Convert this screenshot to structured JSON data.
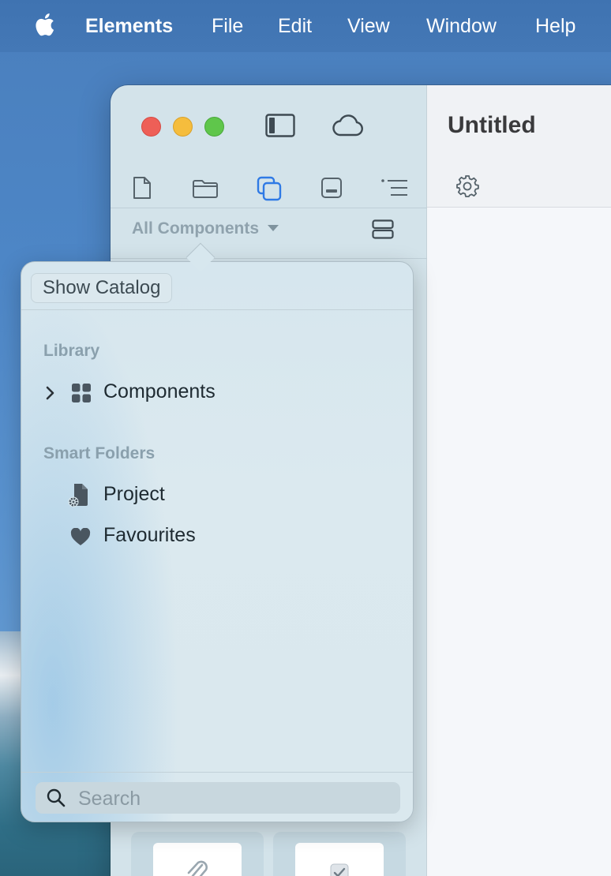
{
  "menubar": {
    "app_name": "Elements",
    "items": [
      "File",
      "Edit",
      "View",
      "Window",
      "Help"
    ]
  },
  "window": {
    "title": "Untitled",
    "filter": {
      "label": "All Components"
    },
    "toolbar_icons": [
      "document-icon",
      "folder-icon",
      "components-icon",
      "inspector-icon",
      "outline-icon"
    ]
  },
  "popover": {
    "show_catalog_label": "Show Catalog",
    "library": {
      "heading": "Library",
      "items": [
        {
          "label": "Components",
          "icon": "grid-icon",
          "expandable": true
        }
      ]
    },
    "smart_folders": {
      "heading": "Smart Folders",
      "items": [
        {
          "label": "Project",
          "icon": "document-gear-icon"
        },
        {
          "label": "Favourites",
          "icon": "heart-icon"
        }
      ]
    },
    "search": {
      "placeholder": "Search"
    }
  },
  "colors": {
    "accent": "#2f7ae5",
    "traffic_close": "#ee5f57",
    "traffic_minimize": "#f5bd3d",
    "traffic_maximize": "#5fc64b"
  }
}
